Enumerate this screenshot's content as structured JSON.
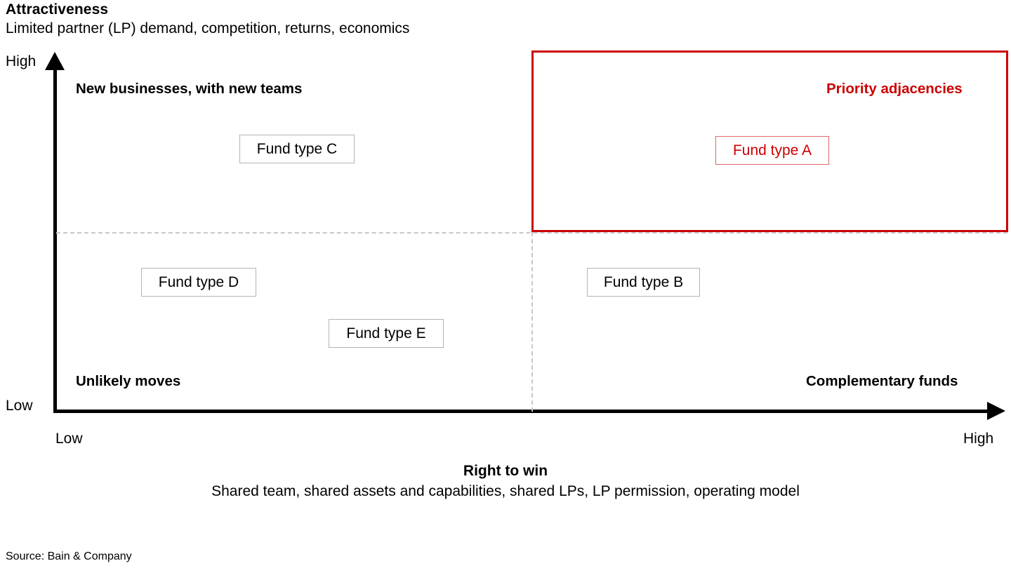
{
  "header": {
    "y_axis_title": "Attractiveness",
    "y_axis_subtitle": "Limited partner (LP) demand, competition, returns, economics"
  },
  "axes": {
    "y_high": "High",
    "y_low": "Low",
    "x_low": "Low",
    "x_high": "High",
    "x_axis_title": "Right to win",
    "x_axis_subtitle": "Shared team, shared assets and capabilities, shared LPs, LP permission, operating model"
  },
  "quadrants": {
    "top_left": "New businesses, with new teams",
    "top_right": "Priority adjacencies",
    "bottom_left": "Unlikely moves",
    "bottom_right": "Complementary funds"
  },
  "markers": {
    "a": "Fund type A",
    "b": "Fund type B",
    "c": "Fund type C",
    "d": "Fund type D",
    "e": "Fund type E"
  },
  "footer": {
    "source": "Source: Bain & Company"
  },
  "colors": {
    "accent_red": "#cc0000",
    "marker_border": "#b3b3b3",
    "marker_border_accent": "#e06666",
    "divider": "#c8c8c8",
    "axis": "#000000"
  },
  "chart_data": {
    "type": "scatter",
    "title": "Attractiveness",
    "subtitle": "Limited partner (LP) demand, competition, returns, economics",
    "xlabel": "Right to win",
    "xlabel_sub": "Shared team, shared assets and capabilities, shared LPs, LP permission, operating model",
    "ylabel": "Attractiveness",
    "ylabel_sub": "Limited partner (LP) demand, competition, returns, economics",
    "xlim": [
      "Low",
      "High"
    ],
    "ylim": [
      "Low",
      "High"
    ],
    "grid": false,
    "legend": "none",
    "quadrant_split": {
      "x": 0.51,
      "y": 0.51
    },
    "quadrant_labels": {
      "top_left": "New businesses, with new teams",
      "top_right": "Priority adjacencies",
      "bottom_left": "Unlikely moves",
      "bottom_right": "Complementary funds"
    },
    "highlight_region": {
      "label": "Priority adjacencies",
      "quadrant": "top_right",
      "color": "#cc0000"
    },
    "points": [
      {
        "label": "Fund type A",
        "x": 0.71,
        "y": 0.79,
        "quadrant": "top_right",
        "highlighted": true
      },
      {
        "label": "Fund type B",
        "x": 0.57,
        "y": 0.41,
        "quadrant": "bottom_right",
        "highlighted": false
      },
      {
        "label": "Fund type C",
        "x": 0.32,
        "y": 0.8,
        "quadrant": "top_left",
        "highlighted": false
      },
      {
        "label": "Fund type D",
        "x": 0.21,
        "y": 0.41,
        "quadrant": "bottom_left",
        "highlighted": false
      },
      {
        "label": "Fund type E",
        "x": 0.41,
        "y": 0.27,
        "quadrant": "bottom_left",
        "highlighted": false
      }
    ],
    "annotations": [
      {
        "text": "Source: Bain & Company",
        "position": "bottom-left"
      }
    ]
  }
}
